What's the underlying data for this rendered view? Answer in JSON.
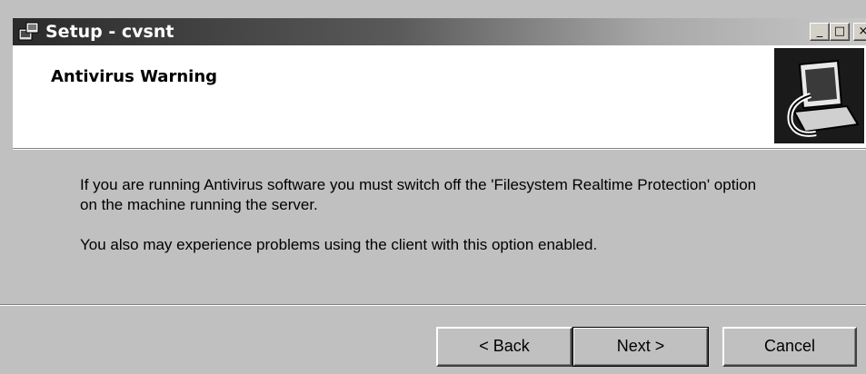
{
  "window": {
    "title": "Setup - cvsnt",
    "icon": "setup-icon",
    "controls": {
      "minimize": "_",
      "maximize": "□",
      "close": "×"
    }
  },
  "header": {
    "heading": "Antivirus Warning",
    "image": "computer-disk-icon"
  },
  "body": {
    "paragraph1": "If you are running Antivirus software you must switch off the 'Filesystem Realtime Protection' option on the machine running the server.",
    "paragraph2": "You also may experience problems using the client with this option enabled."
  },
  "buttons": {
    "back": "< Back",
    "next": "Next >",
    "cancel": "Cancel"
  }
}
